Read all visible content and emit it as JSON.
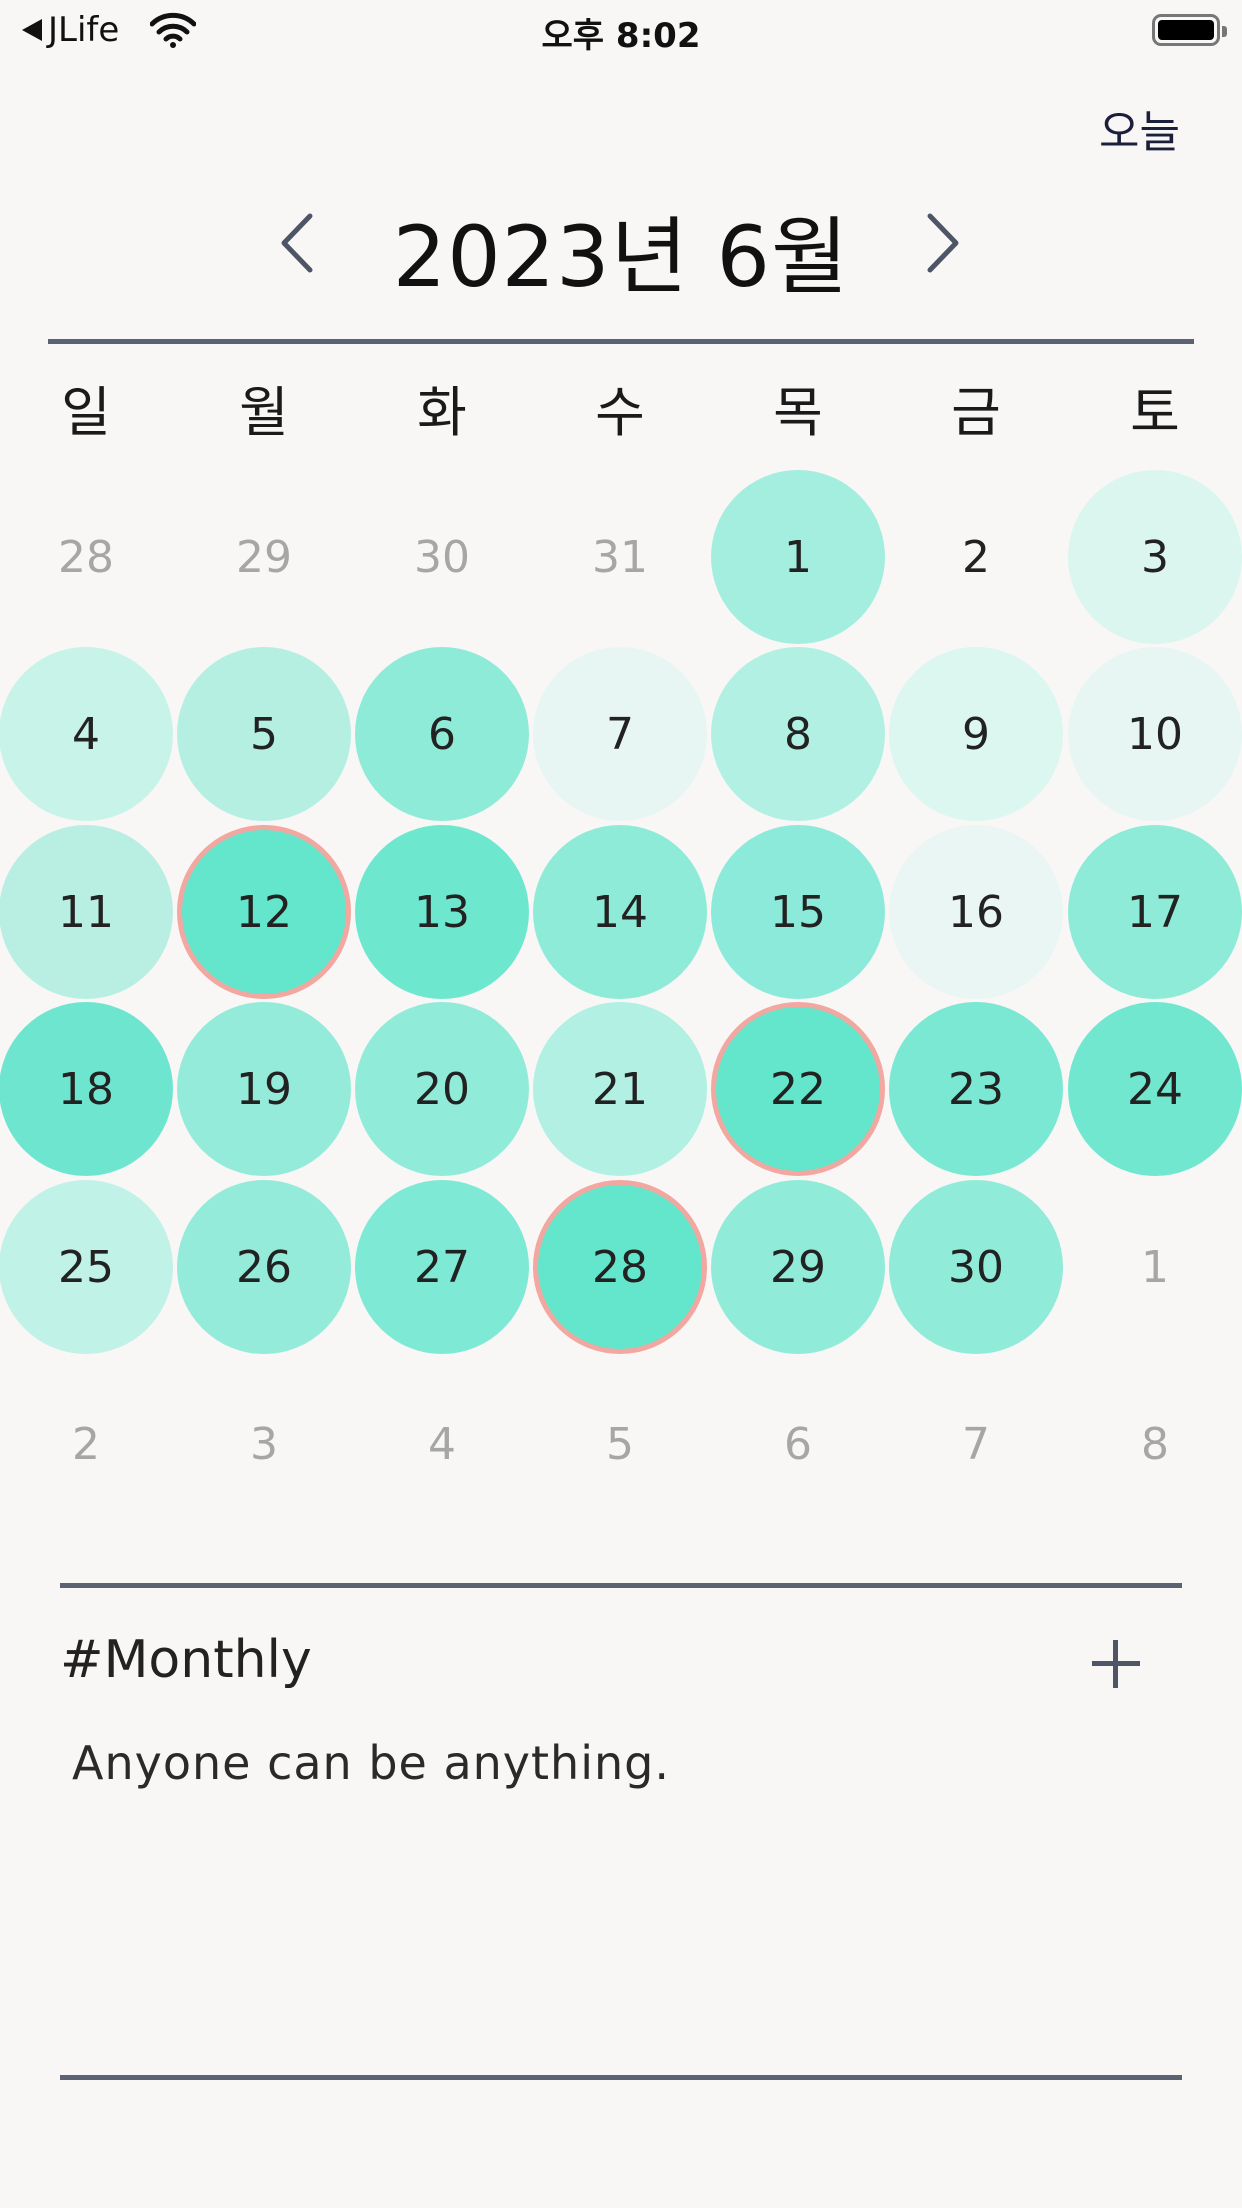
{
  "status_bar": {
    "back_app": "JLife",
    "time": "오후 8:02"
  },
  "header": {
    "today_label": "오늘",
    "month_title": "2023년 6월"
  },
  "weekdays": [
    "일",
    "월",
    "화",
    "수",
    "목",
    "금",
    "토"
  ],
  "calendar": {
    "rows": [
      [
        {
          "d": "28",
          "out": true
        },
        {
          "d": "29",
          "out": true
        },
        {
          "d": "30",
          "out": true
        },
        {
          "d": "31",
          "out": true
        },
        {
          "d": "1",
          "c": "#a3eedf"
        },
        {
          "d": "2"
        },
        {
          "d": "3",
          "c": "#dbf6ef"
        }
      ],
      [
        {
          "d": "4",
          "c": "#c7f3e8"
        },
        {
          "d": "5",
          "c": "#b4efe2"
        },
        {
          "d": "6",
          "c": "#8eebd7"
        },
        {
          "d": "7",
          "c": "#e8f6f3"
        },
        {
          "d": "8",
          "c": "#b2f0e3"
        },
        {
          "d": "9",
          "c": "#dcf6f0"
        },
        {
          "d": "10",
          "c": "#e7f6f3"
        }
      ],
      [
        {
          "d": "11",
          "c": "#b9efe3"
        },
        {
          "d": "12",
          "c": "#63e6cb",
          "m": true
        },
        {
          "d": "13",
          "c": "#6ee7cf"
        },
        {
          "d": "14",
          "c": "#8eebd8"
        },
        {
          "d": "15",
          "c": "#8ceada"
        },
        {
          "d": "16",
          "c": "#eaf6f4"
        },
        {
          "d": "17",
          "c": "#8eebd7"
        }
      ],
      [
        {
          "d": "18",
          "c": "#6ee6cf"
        },
        {
          "d": "19",
          "c": "#95ebda"
        },
        {
          "d": "20",
          "c": "#91ebd9"
        },
        {
          "d": "21",
          "c": "#b2f0e3"
        },
        {
          "d": "22",
          "c": "#63e6cb",
          "m": true
        },
        {
          "d": "23",
          "c": "#7be8d3"
        },
        {
          "d": "24",
          "c": "#72e7d0"
        }
      ],
      [
        {
          "d": "25",
          "c": "#c0f2e7"
        },
        {
          "d": "26",
          "c": "#95ebda"
        },
        {
          "d": "27",
          "c": "#7ee9d4"
        },
        {
          "d": "28",
          "c": "#63e6cb",
          "m": true
        },
        {
          "d": "29",
          "c": "#91ebd9"
        },
        {
          "d": "30",
          "c": "#91ebd9"
        },
        {
          "d": "1",
          "out": true
        }
      ],
      [
        {
          "d": "2",
          "out": true
        },
        {
          "d": "3",
          "out": true
        },
        {
          "d": "4",
          "out": true
        },
        {
          "d": "5",
          "out": true
        },
        {
          "d": "6",
          "out": true
        },
        {
          "d": "7",
          "out": true
        },
        {
          "d": "8",
          "out": true
        }
      ]
    ]
  },
  "monthly": {
    "title": "#Monthly",
    "note": "Anyone can be anything."
  },
  "colors": {
    "divider": "#5c6271",
    "marker_ring": "#f2a7a0",
    "background": "#f8f7f6"
  }
}
